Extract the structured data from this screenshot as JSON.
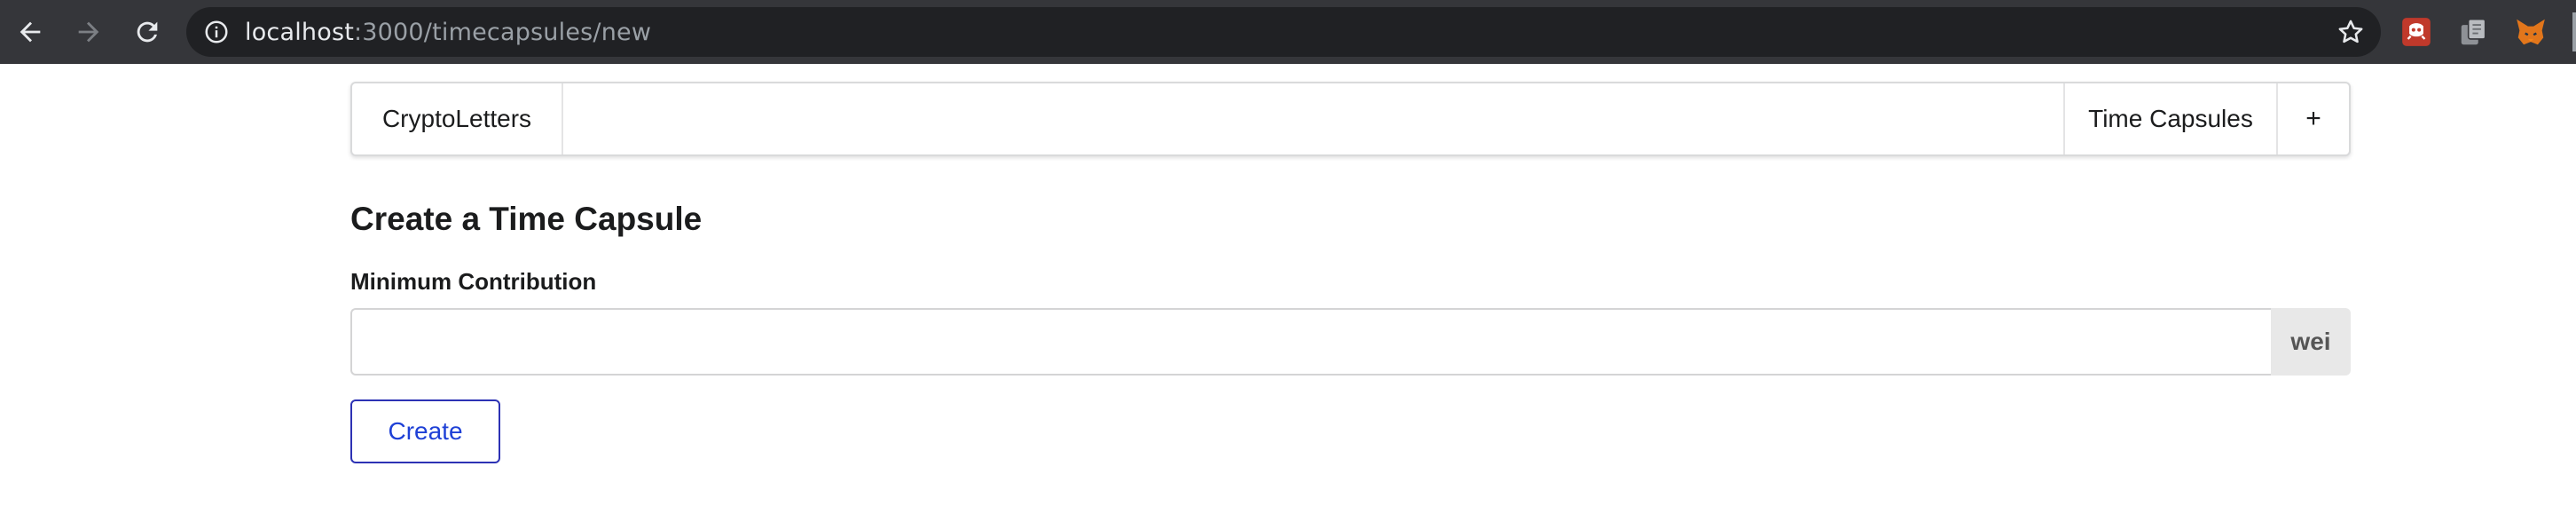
{
  "browser": {
    "url_host": "localhost",
    "url_path": ":3000/timecapsules/new",
    "icons": {
      "back": "back-arrow-icon",
      "forward": "forward-arrow-icon",
      "reload": "reload-icon",
      "site_info": "info-icon",
      "bookmark": "star-icon",
      "extension_1": "red-extension-icon",
      "extension_2": "copy-extension-icon",
      "extension_3": "metamask-fox-icon"
    },
    "colors": {
      "toolbar": "#35363a",
      "omnibox": "#202124"
    }
  },
  "navbar": {
    "brand": "CryptoLetters",
    "items": [
      {
        "label": "Time Capsules"
      },
      {
        "label": "+"
      }
    ]
  },
  "form": {
    "title": "Create a Time Capsule",
    "field_label": "Minimum Contribution",
    "field_value": "",
    "unit": "wei",
    "submit_label": "Create",
    "colors": {
      "submit_border": "#2d32b4",
      "submit_text": "#1e40d6",
      "unit_bg": "#e8e8e8"
    }
  }
}
